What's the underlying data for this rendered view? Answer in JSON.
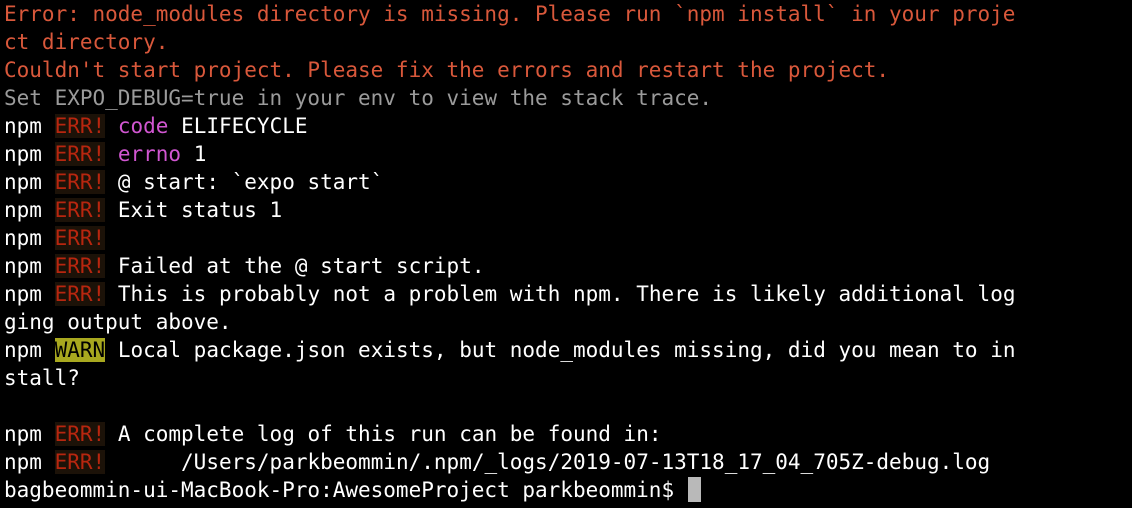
{
  "terminal": {
    "colors": {
      "background": "#000000",
      "error_text": "#d9583b",
      "dim_text": "#9b9b9b",
      "err_badge": "#b8260f",
      "warn_badge_bg": "#a8a81f",
      "keyword": "#d156d1"
    },
    "npm_prefix": "npm",
    "err_badge": "ERR!",
    "warn_badge": "WARN",
    "lines": {
      "error_missing_1": "Error: node_modules directory is missing. Please run `npm install` in your proje",
      "error_missing_2": "ct directory.",
      "couldnt_start": "Couldn't start project. Please fix the errors and restart the project.",
      "expo_debug": "Set EXPO_DEBUG=true in your env to view the stack trace.",
      "code_key": "code",
      "code_val": "ELIFECYCLE",
      "errno_key": "errno",
      "errno_val": "1",
      "start_script": "@ start: `expo start`",
      "exit_status": "Exit status 1",
      "failed_at": "Failed at the @ start script.",
      "probably_1": "This is probably not a problem with npm. There is likely additional log",
      "probably_2": "ging output above.",
      "warn_1": "Local package.json exists, but node_modules missing, did you mean to in",
      "warn_2": "stall?",
      "complete_log": "A complete log of this run can be found in:",
      "log_path": "     /Users/parkbeommin/.npm/_logs/2019-07-13T18_17_04_705Z-debug.log"
    },
    "prompt": {
      "text": "bagbeommin-ui-MacBook-Pro:AwesomeProject parkbeommin$"
    }
  }
}
